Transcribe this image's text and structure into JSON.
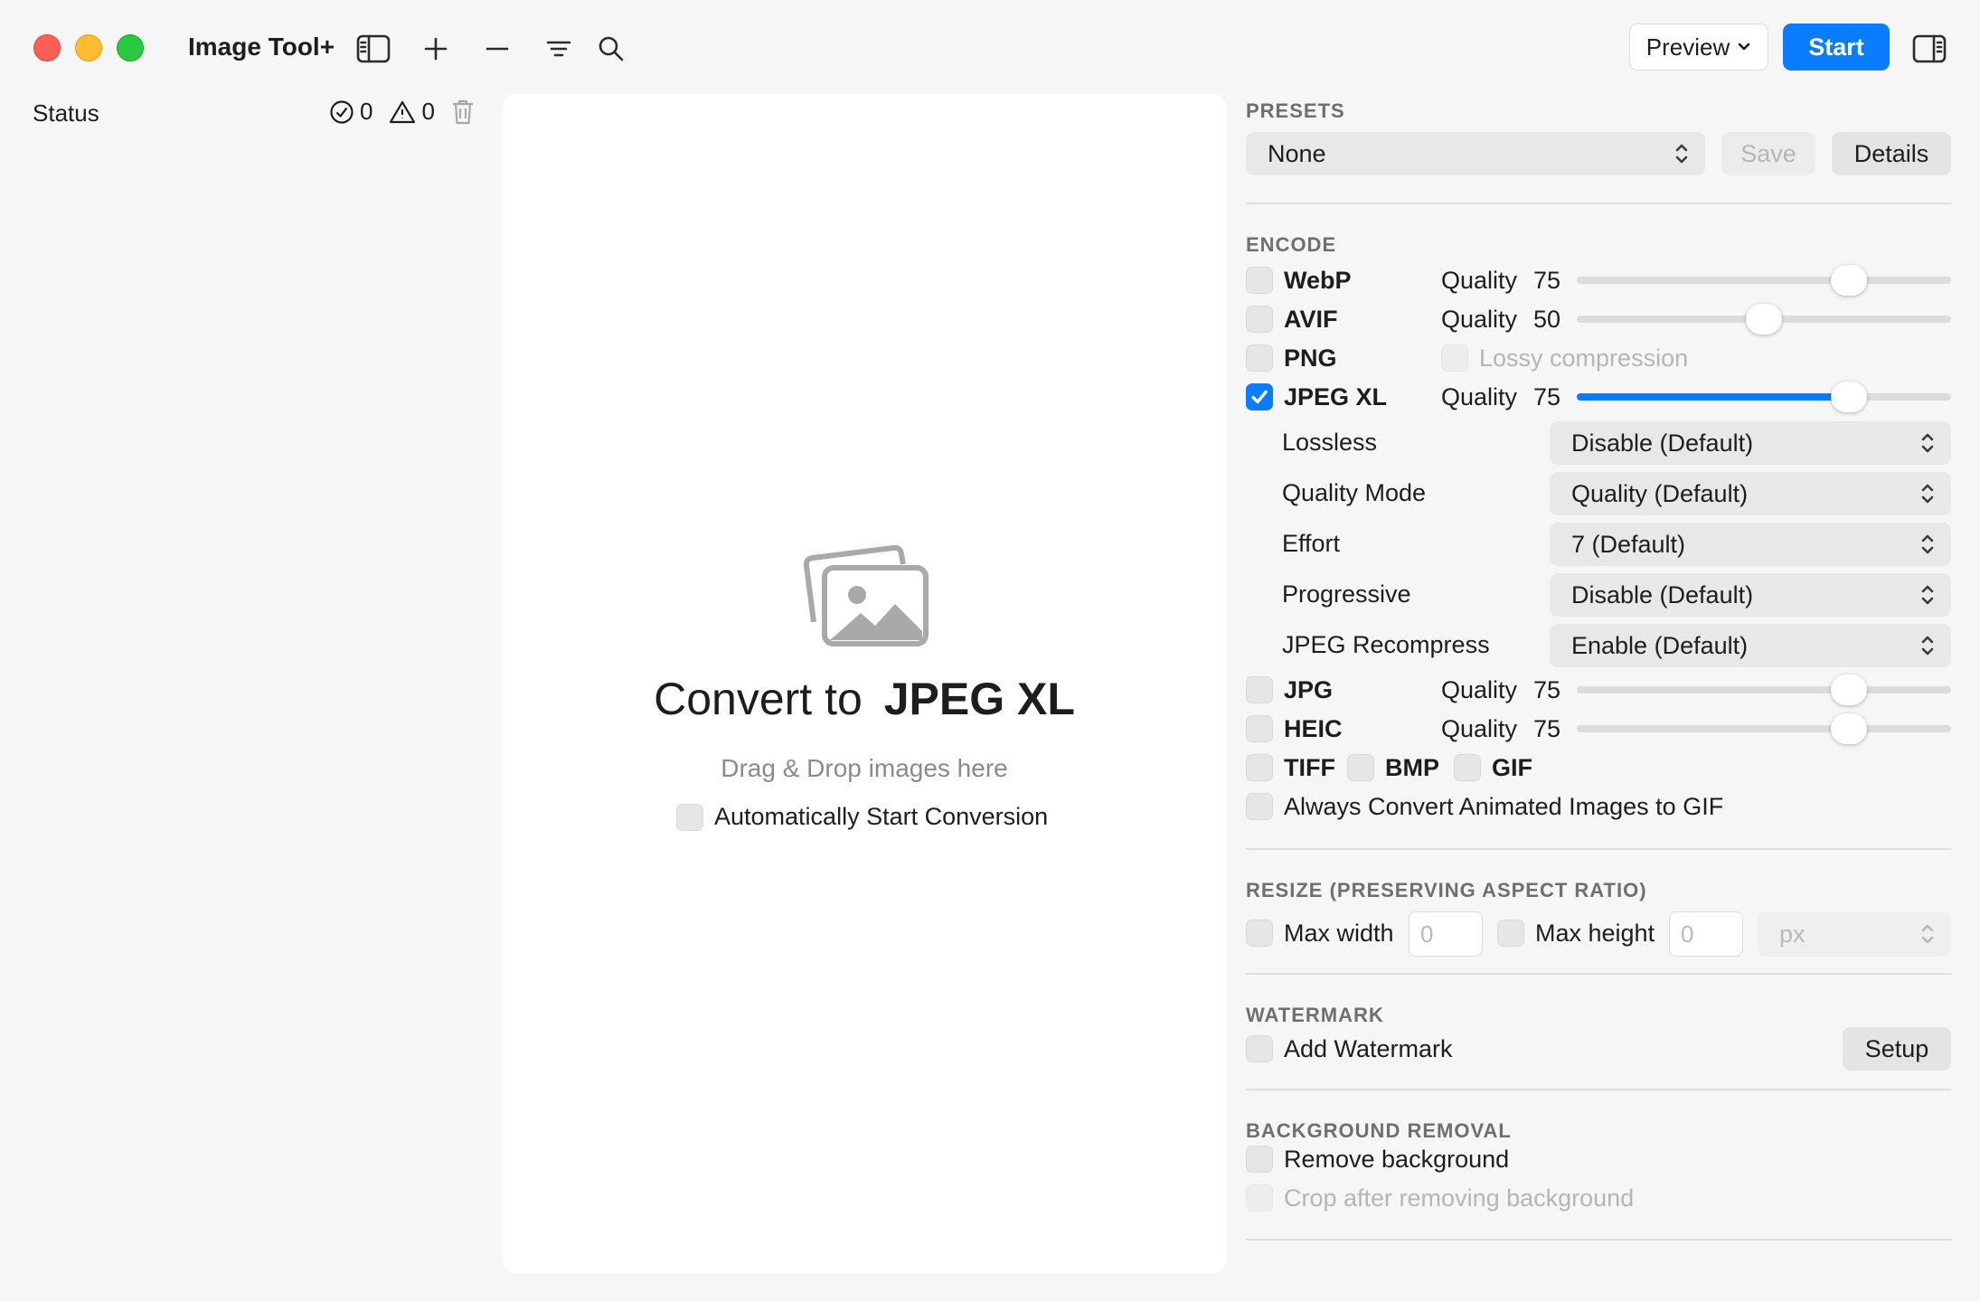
{
  "app": {
    "title": "Image Tool+"
  },
  "toolbar": {
    "preview_label": "Preview",
    "start_label": "Start"
  },
  "sidebar": {
    "status_label": "Status",
    "success_count": "0",
    "warning_count": "0"
  },
  "dropzone": {
    "title_prefix": "Convert to",
    "title_format": "JPEG XL",
    "subtitle": "Drag & Drop images here",
    "auto_start_label": "Automatically Start Conversion",
    "auto_start_checked": false
  },
  "presets": {
    "header": "PRESETS",
    "selected": "None",
    "save_label": "Save",
    "details_label": "Details"
  },
  "encode": {
    "header": "ENCODE",
    "quality_label": "Quality",
    "webp": {
      "label": "WebP",
      "quality": "75",
      "level": 0.75,
      "checked": false
    },
    "avif": {
      "label": "AVIF",
      "quality": "50",
      "level": 0.5,
      "checked": false
    },
    "png": {
      "label": "PNG",
      "lossy_label": "Lossy compression",
      "checked": false
    },
    "jxl": {
      "label": "JPEG XL",
      "quality": "75",
      "level": 0.75,
      "checked": true,
      "options": [
        {
          "label": "Lossless",
          "value": "Disable (Default)"
        },
        {
          "label": "Quality Mode",
          "value": "Quality (Default)"
        },
        {
          "label": "Effort",
          "value": "7 (Default)"
        },
        {
          "label": "Progressive",
          "value": "Disable (Default)"
        },
        {
          "label": "JPEG Recompress",
          "value": "Enable (Default)"
        }
      ]
    },
    "jpg": {
      "label": "JPG",
      "quality": "75",
      "level": 0.75,
      "checked": false
    },
    "heic": {
      "label": "HEIC",
      "quality": "75",
      "level": 0.75,
      "checked": false
    },
    "tiff": {
      "label": "TIFF"
    },
    "bmp": {
      "label": "BMP"
    },
    "gif": {
      "label": "GIF"
    },
    "animated_gif_label": "Always Convert Animated Images to GIF"
  },
  "resize": {
    "header": "RESIZE (PRESERVING ASPECT RATIO)",
    "max_width_label": "Max width",
    "max_width_placeholder": "0",
    "max_height_label": "Max height",
    "max_height_placeholder": "0",
    "unit": "px"
  },
  "watermark": {
    "header": "WATERMARK",
    "add_label": "Add Watermark",
    "setup_label": "Setup"
  },
  "background_removal": {
    "header": "BACKGROUND REMOVAL",
    "remove_label": "Remove background",
    "crop_label": "Crop after removing background"
  },
  "colors": {
    "accent": "#0a7cff",
    "close": "#ff5f57",
    "minimize": "#febc2e",
    "maximize": "#28c840"
  },
  "icons": [
    "sidebar-toggle-icon",
    "plus-icon",
    "minus-icon",
    "filter-lines-icon",
    "search-icon",
    "inspector-toggle-icon",
    "checkmark-circle-icon",
    "warning-triangle-icon",
    "trash-icon",
    "photo-stack-icon",
    "updown-chevron-icon"
  ]
}
